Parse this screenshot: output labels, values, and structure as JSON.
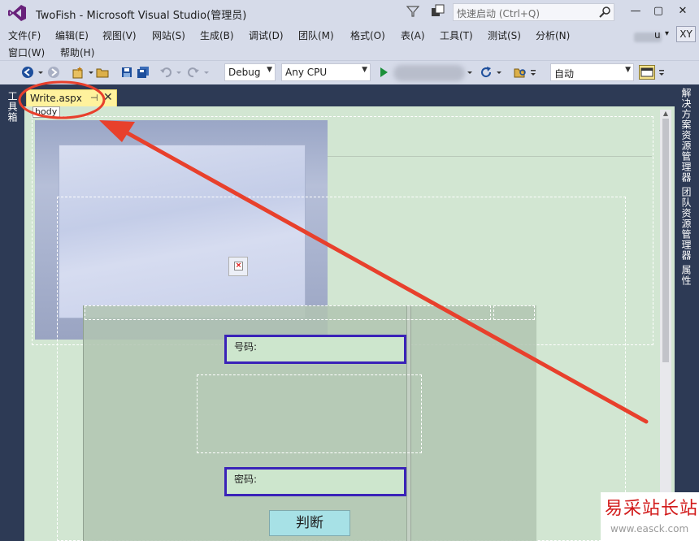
{
  "window": {
    "title": "TwoFish - Microsoft Visual Studio(管理员)",
    "quick_launch_placeholder": "快速启动 (Ctrl+Q)",
    "minimize": "—",
    "maximize": "▢",
    "close": "✕",
    "user_suffix": "u",
    "user_caret": "▾",
    "avatar": "XY"
  },
  "menu": {
    "row1": [
      "文件(F)",
      "编辑(E)",
      "视图(V)",
      "网站(S)",
      "生成(B)",
      "调试(D)",
      "团队(M)",
      "格式(O)",
      "表(A)",
      "工具(T)",
      "测试(S)",
      "分析(N)"
    ],
    "row2": [
      "窗口(W)",
      "帮助(H)"
    ]
  },
  "toolbar": {
    "configuration": "Debug",
    "platform": "Any CPU",
    "zoom": "自动"
  },
  "side_panels": {
    "left": "工具箱",
    "right": [
      "解决方案资源管理器",
      "团队资源管理器",
      "属性"
    ]
  },
  "editor": {
    "tab_label": "Write.aspx",
    "tab_pin": "⊣",
    "tab_close": "✕",
    "breadcrumb": "body"
  },
  "form": {
    "phone_label": "号码:",
    "password_label": "密码:",
    "submit_label": "判断"
  },
  "watermark": {
    "title": "易采站长站",
    "url": "www.easck.com"
  },
  "colors": {
    "chrome_bg": "#d6dbe9",
    "dark_bg": "#2d3a55",
    "tab_active": "#fff29d",
    "design_surface": "#d2e6d2",
    "field_border": "#3a22b8",
    "button_fill": "#a7e1e6",
    "annotation": "#e8402c"
  }
}
